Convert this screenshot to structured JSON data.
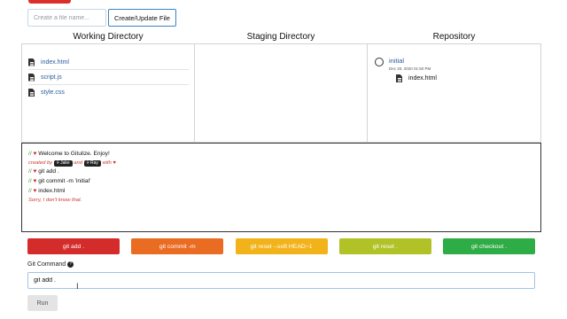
{
  "file_form": {
    "placeholder": "Create a file name...",
    "button": "Create/Update File"
  },
  "columns": {
    "working": "Working Directory",
    "staging": "Staging Directory",
    "repository": "Repository"
  },
  "working_files": [
    "index.html",
    "script.js",
    "style.css"
  ],
  "repository": {
    "commit_name": "initial",
    "commit_date": "Dec 20, 2020 01:50 PM",
    "file": "index.html"
  },
  "terminal": {
    "welcome": "Welcome to Gitulize. Enjoy!",
    "created_by": "created by",
    "author1": "Jake",
    "and": "and",
    "author2": "Ray",
    "with": "with",
    "lines": [
      "git add .",
      "git commit -m 'initial'",
      "index.html"
    ],
    "error": "Sorry, I don't know that.",
    "comment_prefix": "//",
    "heart": "♥"
  },
  "commands": [
    {
      "label": "git add .",
      "color": "#d42b2b"
    },
    {
      "label": "git commit -m",
      "color": "#ea6b22"
    },
    {
      "label": "git reset --soft HEAD~1",
      "color": "#f2b21a"
    },
    {
      "label": "git reset .",
      "color": "#b1c226"
    },
    {
      "label": "git checkout .",
      "color": "#2eac45"
    }
  ],
  "git_command": {
    "label": "Git Command",
    "help_icon": "question-circle-icon",
    "value": "git add ."
  },
  "run_label": "Run"
}
